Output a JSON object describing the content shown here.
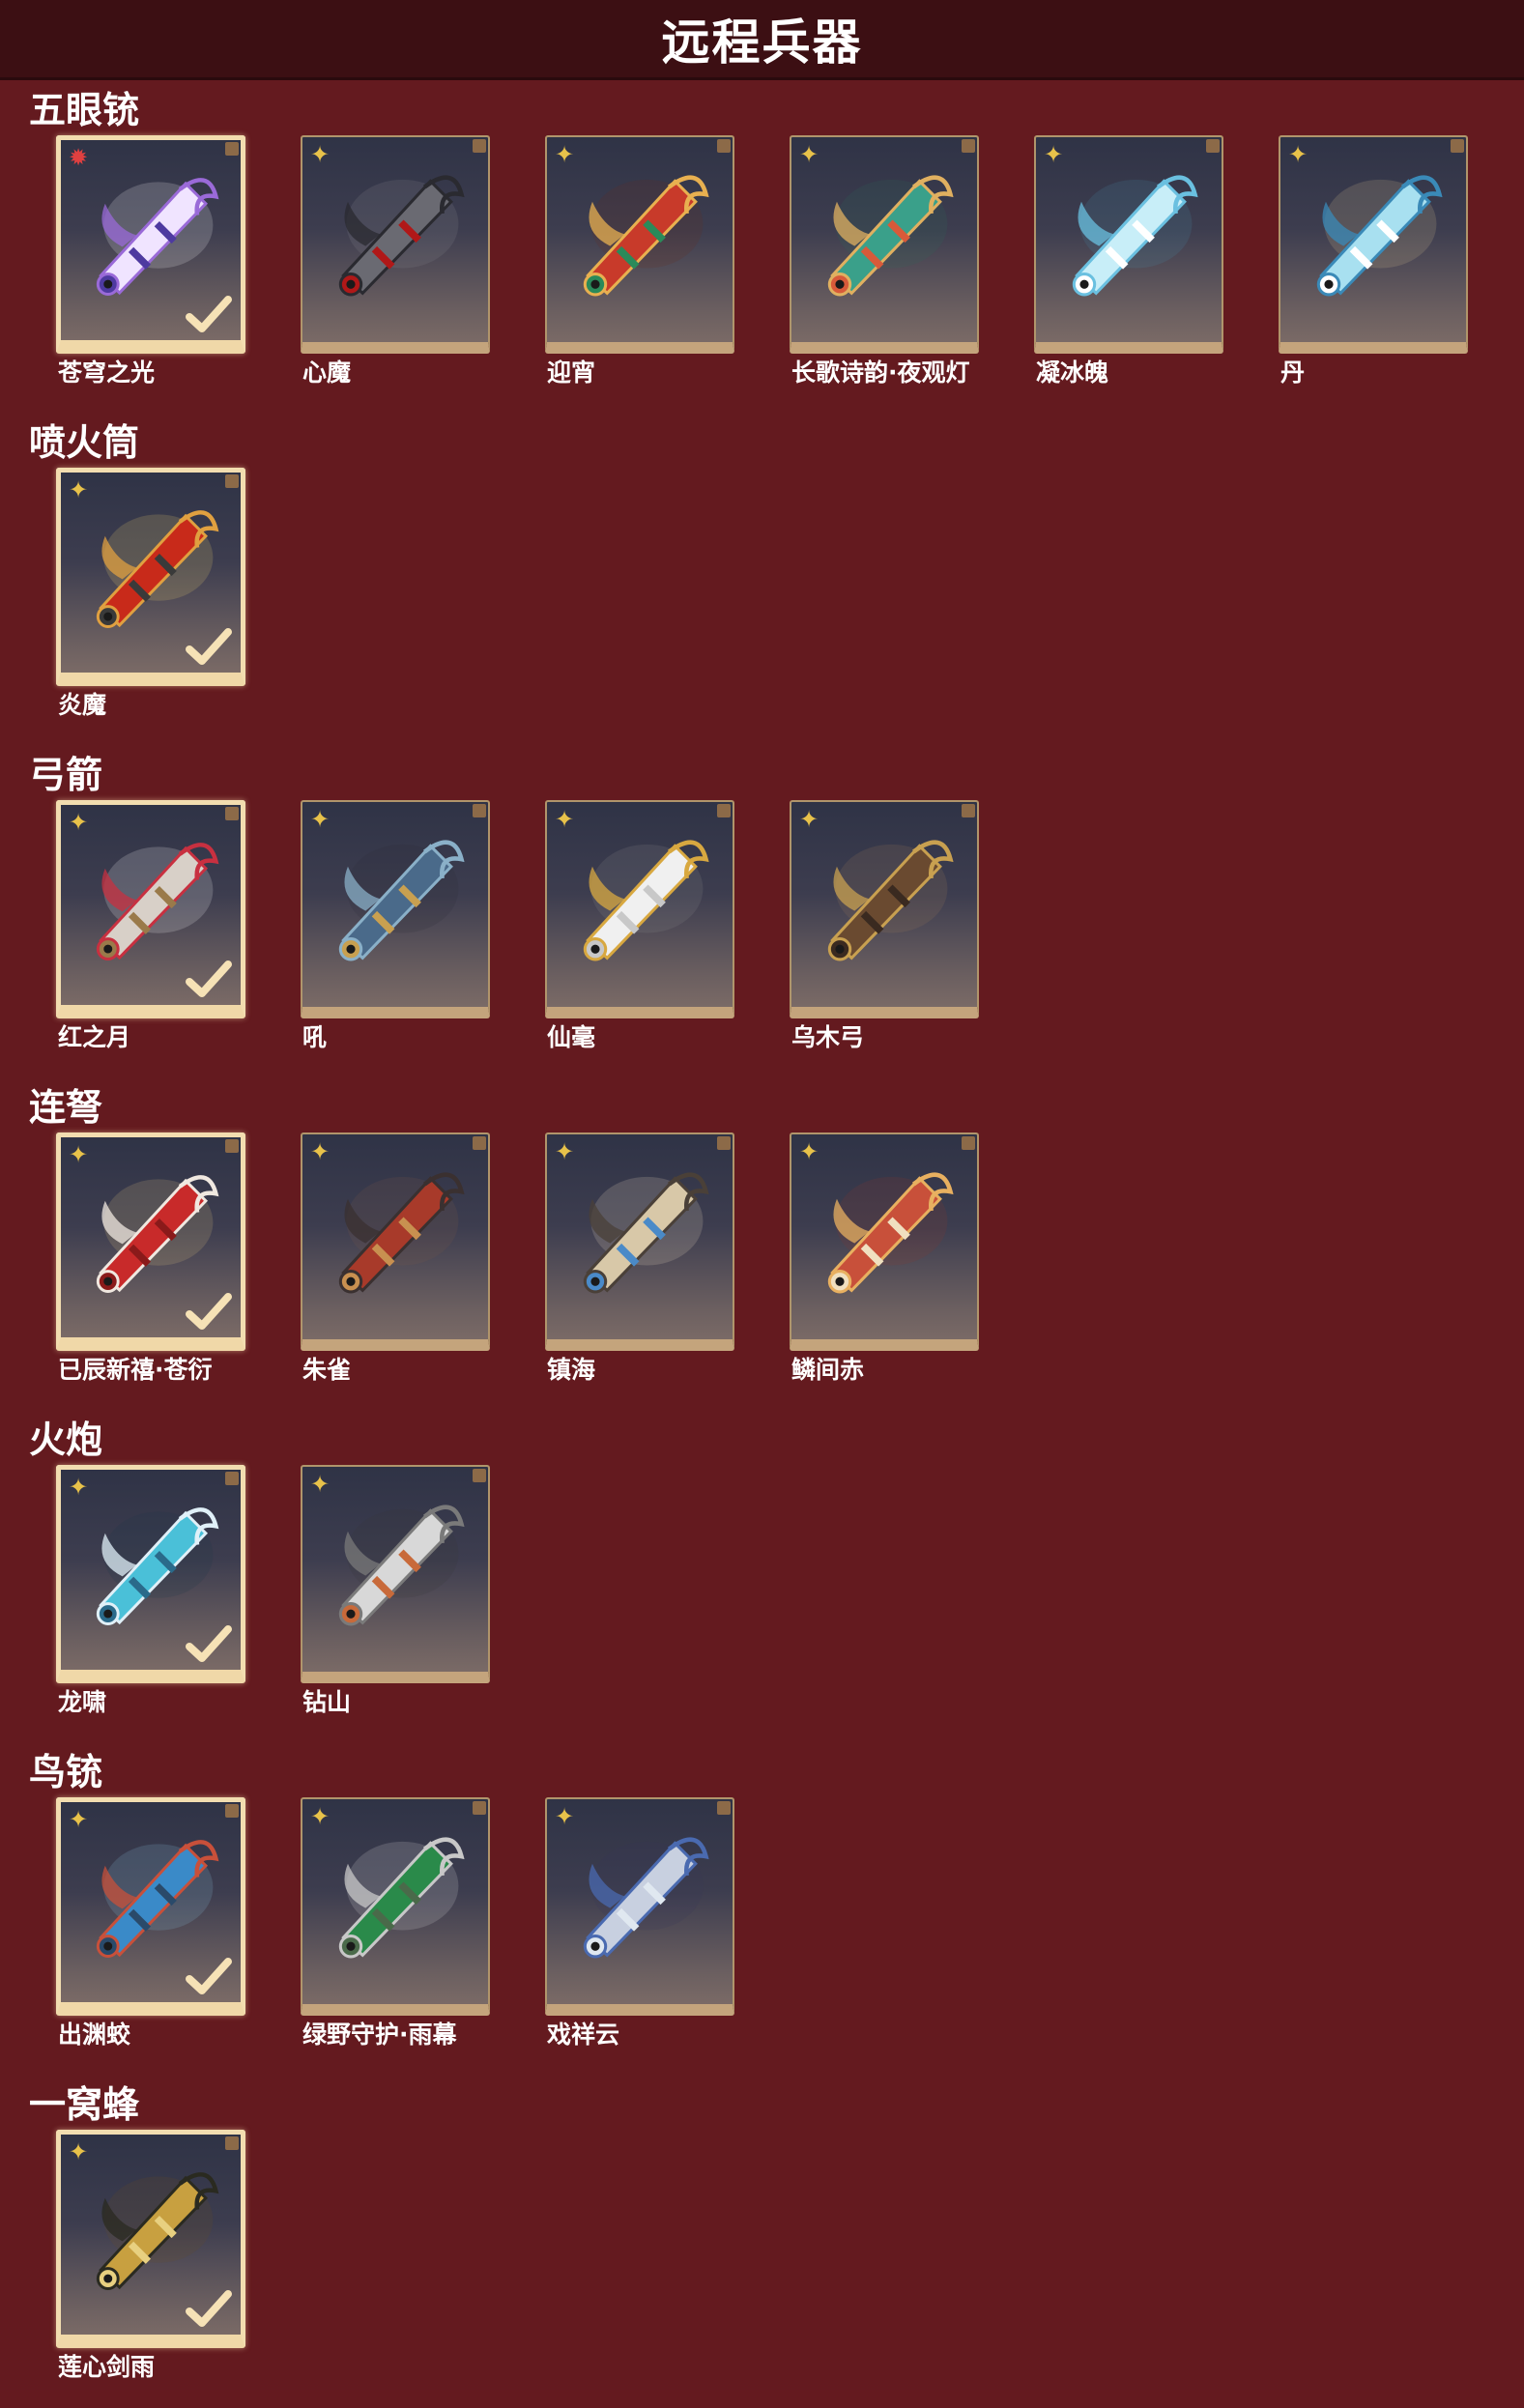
{
  "page": {
    "title": "远程兵器"
  },
  "categories": [
    {
      "title": "五眼铳",
      "items": [
        {
          "name": "苍穹之光",
          "owned": true,
          "rarity": "red-star",
          "art": "violet-ghost-gun"
        },
        {
          "name": "心魔",
          "owned": false,
          "rarity": "gold-star",
          "art": "dark-demon-gun"
        },
        {
          "name": "迎宵",
          "owned": false,
          "rarity": "gold-star",
          "art": "red-lion-gun"
        },
        {
          "name": "长歌诗韵·夜观灯",
          "owned": false,
          "rarity": "gold-star",
          "art": "teal-fish-gun"
        },
        {
          "name": "凝冰魄",
          "owned": false,
          "rarity": "gold-star",
          "art": "ice-crystal-gun"
        },
        {
          "name": "丹",
          "owned": false,
          "rarity": "gold-star",
          "art": "blue-porcelain-gun"
        }
      ]
    },
    {
      "title": "喷火筒",
      "items": [
        {
          "name": "炎魔",
          "owned": true,
          "rarity": "gold-star",
          "art": "red-flame-cannon"
        }
      ]
    },
    {
      "title": "弓箭",
      "items": [
        {
          "name": "红之月",
          "owned": true,
          "rarity": "gold-star",
          "art": "red-moon-bow"
        },
        {
          "name": "吼",
          "owned": false,
          "rarity": "gold-star",
          "art": "blue-beast-bow"
        },
        {
          "name": "仙毫",
          "owned": false,
          "rarity": "gold-star",
          "art": "white-brush-bow"
        },
        {
          "name": "乌木弓",
          "owned": false,
          "rarity": "gold-star",
          "art": "ebony-wood-bow"
        }
      ]
    },
    {
      "title": "连弩",
      "items": [
        {
          "name": "已辰新禧·苍衍",
          "owned": true,
          "rarity": "gold-star",
          "art": "red-dragon-crossbow"
        },
        {
          "name": "朱雀",
          "owned": false,
          "rarity": "gold-star",
          "art": "vermilion-bird-crossbow"
        },
        {
          "name": "镇海",
          "owned": false,
          "rarity": "gold-star",
          "art": "sea-guard-crossbow"
        },
        {
          "name": "鳞间赤",
          "owned": false,
          "rarity": "gold-star",
          "art": "red-carp-crossbow"
        }
      ]
    },
    {
      "title": "火炮",
      "items": [
        {
          "name": "龙啸",
          "owned": true,
          "rarity": "gold-star",
          "art": "cyan-dragon-cannon"
        },
        {
          "name": "钻山",
          "owned": false,
          "rarity": "gold-star",
          "art": "silver-drill-cannon"
        }
      ]
    },
    {
      "title": "鸟铳",
      "items": [
        {
          "name": "出渊蛟",
          "owned": true,
          "rarity": "gold-star",
          "art": "blue-serpent-musket"
        },
        {
          "name": "绿野守护·雨幕",
          "owned": false,
          "rarity": "gold-star",
          "art": "green-tassel-musket"
        },
        {
          "name": "戏祥云",
          "owned": false,
          "rarity": "gold-star",
          "art": "silver-cloud-musket"
        }
      ]
    },
    {
      "title": "一窝蜂",
      "items": [
        {
          "name": "莲心剑雨",
          "owned": true,
          "rarity": "gold-star",
          "art": "gold-lotus-launcher"
        }
      ]
    }
  ],
  "icons": {
    "gold_star": "✦",
    "red_star": "✹",
    "check": "check-icon"
  },
  "colors": {
    "background": "#641a1f",
    "header": "#3c0f13",
    "owned_frame": "#f2ddb0",
    "card_frame": "#c4a47c",
    "star_gold": "#e8c24a",
    "star_red": "#e04040"
  }
}
